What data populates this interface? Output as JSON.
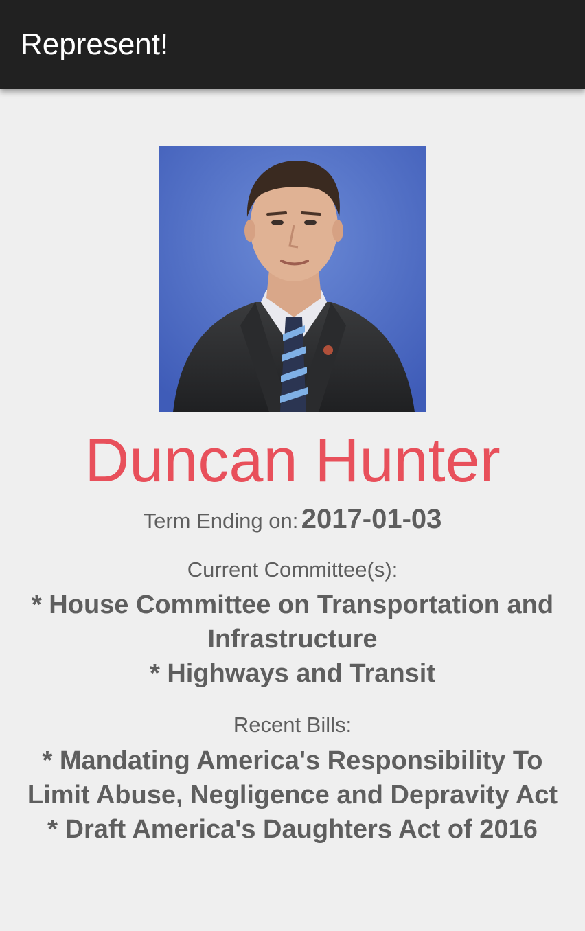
{
  "app_bar": {
    "title": "Represent!"
  },
  "representative": {
    "name": "Duncan Hunter",
    "photo_icon": "person-portrait-icon",
    "term_label": "Term Ending on:",
    "term_end": "2017-01-03"
  },
  "committees": {
    "heading": "Current Committee(s):",
    "items": [
      "* House Committee on Transportation and Infrastructure",
      "* Highways and Transit"
    ]
  },
  "bills": {
    "heading": "Recent Bills:",
    "items": [
      "* Mandating America's Responsibility To Limit Abuse, Negligence and Depravity Act",
      "* Draft America's Daughters Act of 2016"
    ]
  },
  "colors": {
    "app_bar": "#212121",
    "background": "#efefef",
    "name_accent": "#e8505b",
    "body_text": "#5e5e5e",
    "photo_background": "#4a6ac4"
  }
}
